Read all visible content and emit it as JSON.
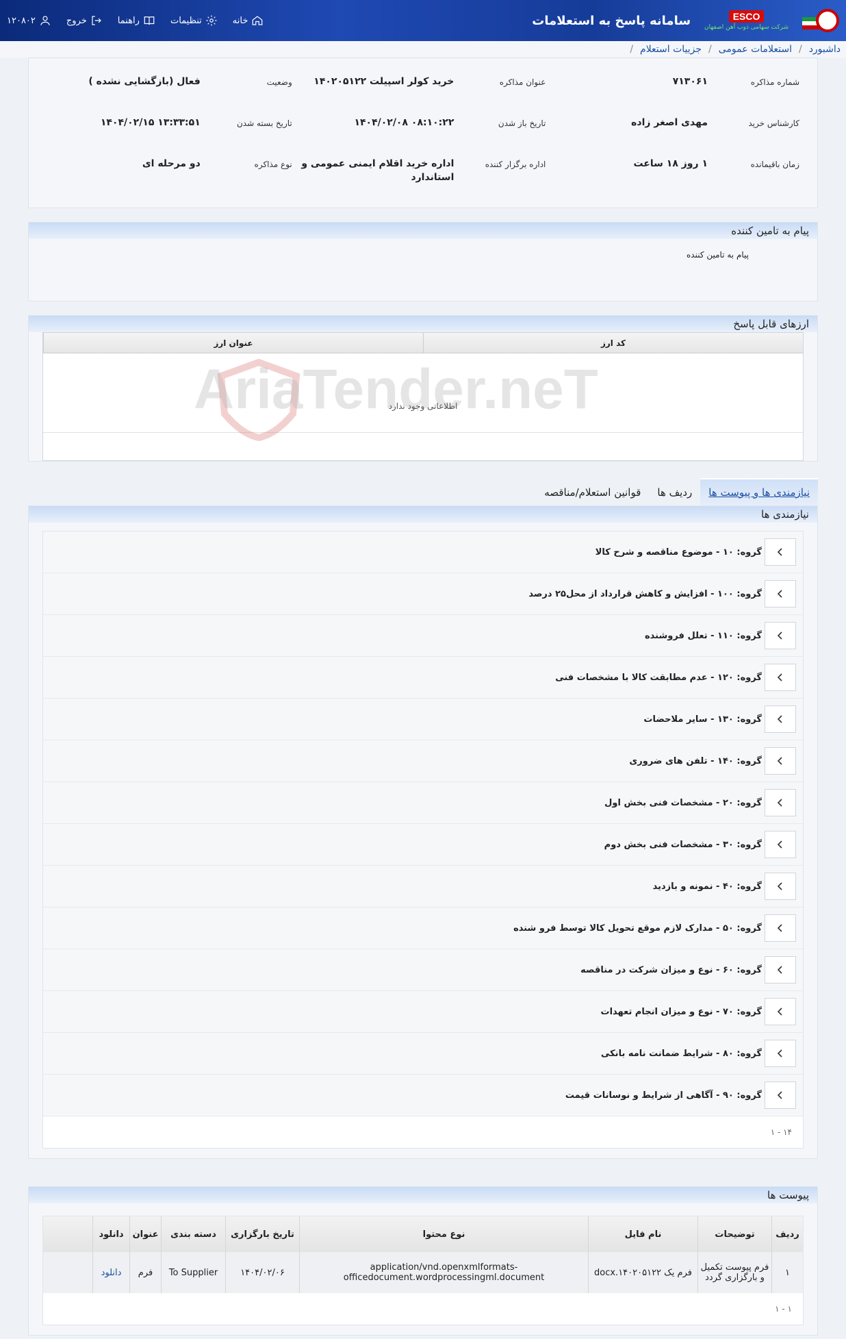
{
  "header": {
    "system_title": "سامانه پاسخ به استعلامات",
    "brand": "ESCO",
    "brand_sub": "شرکت سهامی ذوب آهن اصفهان",
    "user_id": "۱۲۰۸۰۲",
    "nav": {
      "home": "خانه",
      "settings": "تنظیمات",
      "guide": "راهنما",
      "logout": "خروج"
    }
  },
  "breadcrumb": [
    "داشبورد",
    "استعلامات عمومی",
    "جزییات استعلام"
  ],
  "info": {
    "rows": [
      [
        {
          "label": "شماره مذاکره",
          "value": "۷۱۳۰۶۱"
        },
        {
          "label": "عنوان مذاکره",
          "value": "خرید کولر اسپیلت ۱۴۰۲۰۵۱۲۲"
        },
        {
          "label": "وضعیت",
          "value": "فعال (بازگشایی نشده )"
        }
      ],
      [
        {
          "label": "کارشناس خرید",
          "value": "مهدی اصغر زاده"
        },
        {
          "label": "تاریخ باز شدن",
          "value": "۰۸:۱۰:۲۲ ۱۴۰۴/۰۲/۰۸"
        },
        {
          "label": "تاریخ بسته شدن",
          "value": "۱۳:۳۳:۵۱ ۱۴۰۴/۰۲/۱۵"
        }
      ],
      [
        {
          "label": "زمان باقیمانده",
          "value": "۱ روز ۱۸ ساعت"
        },
        {
          "label": "اداره برگزار کننده",
          "value": "اداره خرید اقلام ایمنی عمومی و استاندارد"
        },
        {
          "label": "نوع مذاکره",
          "value": "دو مرحله ای"
        }
      ]
    ]
  },
  "supplier_message": {
    "title": "پیام به تامین کننده",
    "body": "پیام به تامین کننده"
  },
  "currencies": {
    "title": "ارزهای قابل پاسخ",
    "columns": [
      "کد ارز",
      "عنوان ارز"
    ],
    "empty_text": "اطلاعاتی وجود ندارد",
    "watermark": "AriaTender.neT"
  },
  "tabs": [
    "نیازمندی ها و پیوست ها",
    "ردیف ها",
    "قوانین استعلام/مناقصه"
  ],
  "requirements": {
    "title": "نیازمندی ها",
    "groups": [
      "گروه: ۱۰ - موضوع مناقصه و شرح کالا",
      "گروه: ۱۰۰ - افزایش و کاهش قرارداد از محل۲۵ درصد",
      "گروه: ۱۱۰ - تعلل فروشنده",
      "گروه: ۱۲۰ - عدم مطابقت کالا با مشخصات فنی",
      "گروه: ۱۳۰ - سایر ملاحضات",
      "گروه: ۱۴۰ - تلفن های ضروری",
      "گروه: ۲۰ - مشخصات فنی بخش اول",
      "گروه: ۳۰ - مشخصات فنی بخش دوم",
      "گروه: ۴۰ - نمونه و بازدید",
      "گروه: ۵۰ - مدارک لازم موقع تحویل کالا توسط فرو شنده",
      "گروه: ۶۰ - نوع و میزان شرکت در مناقصه",
      "گروه: ۷۰ - نوع و میزان انجام تعهدات",
      "گروه: ۸۰ - شرایط ضمانت نامه بانکی",
      "گروه: ۹۰ - آگاهی از شرایط و نوسانات قیمت"
    ],
    "pager": "۱۴ - ۱"
  },
  "attachments": {
    "title": "پیوست ها",
    "columns": [
      "ردیف",
      "توضیحات",
      "نام فایل",
      "نوع محتوا",
      "تاریخ بارگزاری",
      "دسته بندی",
      "عنوان",
      "دانلود"
    ],
    "rows": [
      {
        "index": "۱",
        "description": "فرم پیوست تکمیل و بارگزاری گردد",
        "file_name": "فرم یک ۱۴۰۲۰۵۱۲۲.docx",
        "content_type": "application/vnd.openxmlformats-officedocument.wordprocessingml.document",
        "upload_date": "۱۴۰۴/۰۲/۰۶",
        "category": "To Supplier",
        "title": "فرم",
        "download": "دانلود"
      }
    ],
    "pager": "۱ - ۱"
  }
}
